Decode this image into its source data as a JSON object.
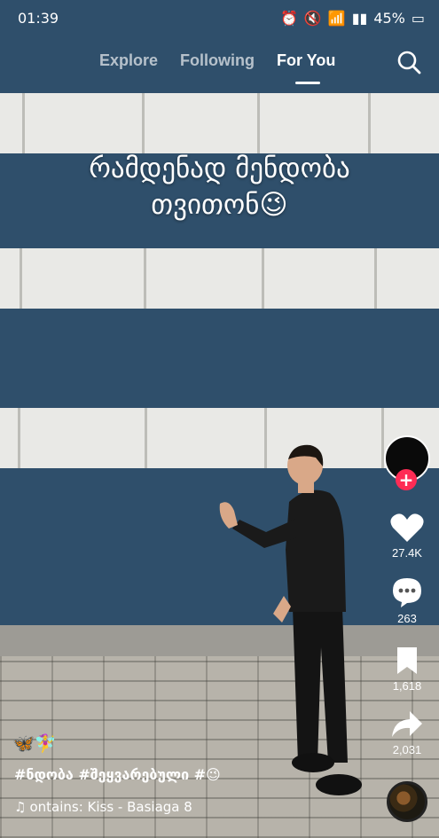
{
  "status_bar": {
    "time": "01:39",
    "battery": "45%"
  },
  "top_nav": {
    "tabs": [
      {
        "label": "Explore"
      },
      {
        "label": "Following"
      },
      {
        "label": "For You",
        "active": true
      }
    ],
    "search_icon": "search-icon"
  },
  "video": {
    "caption_line1": "რამდენად მენდობა",
    "caption_line2": "თვითონ😉"
  },
  "right_rail": {
    "likes": "27.4K",
    "comments": "263",
    "bookmarks": "1,618",
    "shares": "2,031"
  },
  "post_info": {
    "emoji_line": "🦋🧚‍♀️",
    "hashtags": "#ნდობა #შეყვარებული #😉",
    "sound": "ontains: Kiss - Basiaga 8"
  },
  "colors": {
    "accent": "#fe2c55",
    "wall": "#2f4f6b"
  }
}
